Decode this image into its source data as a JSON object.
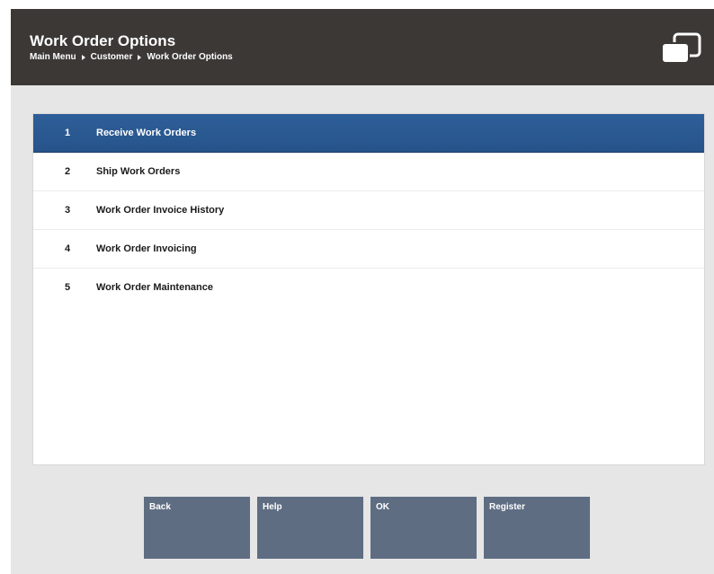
{
  "header": {
    "title": "Work Order Options",
    "breadcrumb": [
      "Main Menu",
      "Customer",
      "Work Order Options"
    ]
  },
  "menu": {
    "items": [
      {
        "number": "1",
        "label": "Receive Work Orders",
        "selected": true
      },
      {
        "number": "2",
        "label": "Ship Work Orders",
        "selected": false
      },
      {
        "number": "3",
        "label": "Work Order Invoice History",
        "selected": false
      },
      {
        "number": "4",
        "label": "Work Order Invoicing",
        "selected": false
      },
      {
        "number": "5",
        "label": "Work Order Maintenance",
        "selected": false
      }
    ]
  },
  "buttons": {
    "back": "Back",
    "help": "Help",
    "ok": "OK",
    "register": "Register"
  },
  "colors": {
    "header_bg": "#3b3836",
    "selected_row": "#2e5f99",
    "button_bg": "#5e6d82",
    "panel_bg": "#e6e6e6"
  }
}
